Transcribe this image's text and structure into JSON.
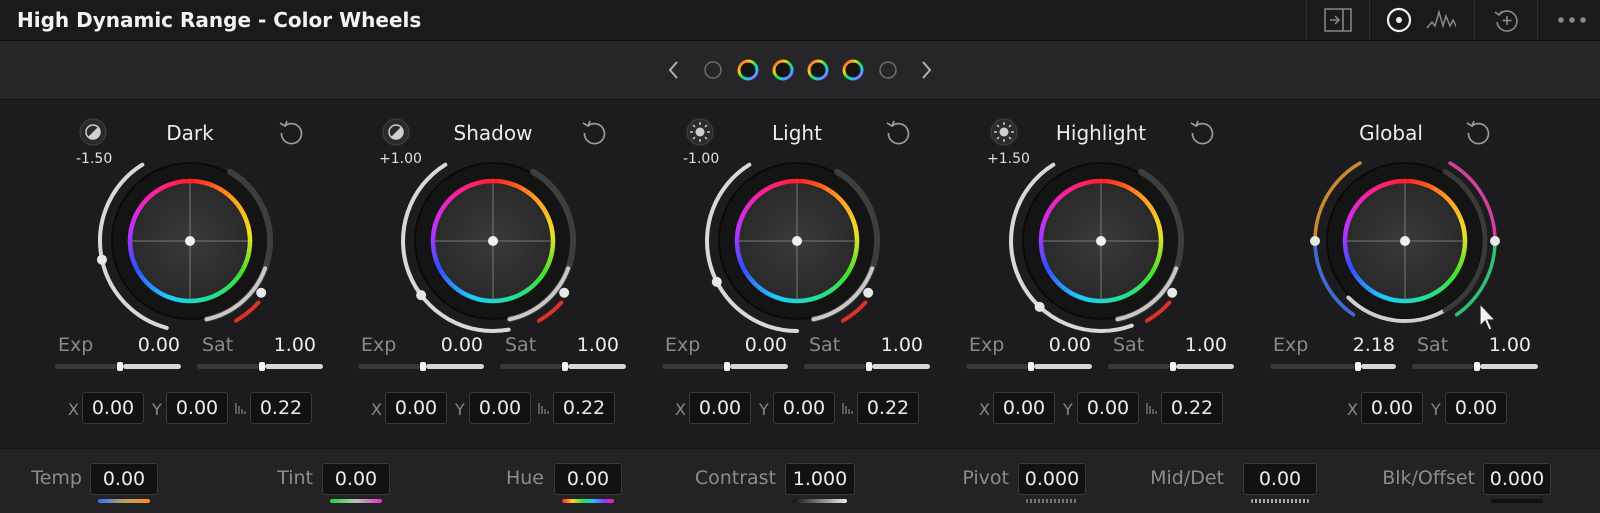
{
  "panel": {
    "title": "High Dynamic Range - Color Wheels"
  },
  "toolbar": {
    "icons": [
      "expand-panel-icon",
      "color-wheel-icon",
      "waveform-icon",
      "add-reset-icon",
      "more-options-icon"
    ]
  },
  "wheels": [
    {
      "name": "Dark",
      "zone": "-1.50",
      "exp": "0.00",
      "sat": "1.00",
      "x": "0.00",
      "y": "0.00",
      "falloff": "0.22"
    },
    {
      "name": "Shadow",
      "zone": "+1.00",
      "exp": "0.00",
      "sat": "1.00",
      "x": "0.00",
      "y": "0.00",
      "falloff": "0.22"
    },
    {
      "name": "Light",
      "zone": "-1.00",
      "exp": "0.00",
      "sat": "1.00",
      "x": "0.00",
      "y": "0.00",
      "falloff": "0.22"
    },
    {
      "name": "Highlight",
      "zone": "+1.50",
      "exp": "0.00",
      "sat": "1.00",
      "x": "0.00",
      "y": "0.00",
      "falloff": "0.22"
    },
    {
      "name": "Global",
      "exp": "2.18",
      "sat": "1.00",
      "x": "0.00",
      "y": "0.00"
    }
  ],
  "labels": {
    "exp": "Exp",
    "sat": "Sat",
    "x": "X",
    "y": "Y"
  },
  "bottom": [
    {
      "label": "Temp",
      "value": "0.00"
    },
    {
      "label": "Tint",
      "value": "0.00"
    },
    {
      "label": "Hue",
      "value": "0.00"
    },
    {
      "label": "Contrast",
      "value": "1.000"
    },
    {
      "label": "Pivot",
      "value": "0.000"
    },
    {
      "label": "Mid/Det",
      "value": "0.00"
    },
    {
      "label": "Blk/Offset",
      "value": "0.000"
    }
  ],
  "colors": {
    "background": "#1c1c1e",
    "accent_red": "#e0302a"
  }
}
